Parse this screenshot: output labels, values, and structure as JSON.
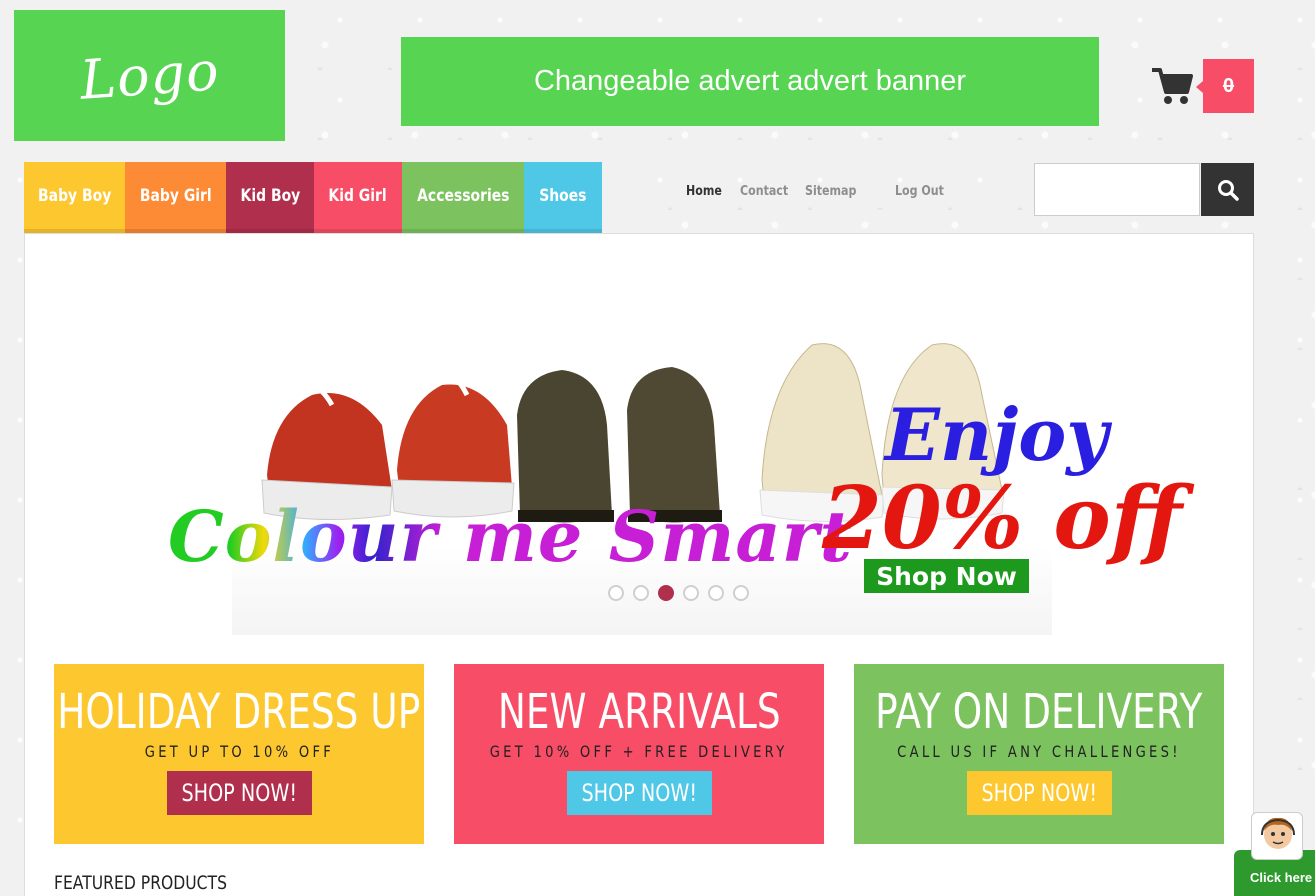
{
  "header": {
    "logo": "Logo",
    "advert": "Changeable advert advert banner",
    "cart_count": "0"
  },
  "categories": [
    {
      "label": "Baby Boy",
      "color": "#fdc72f"
    },
    {
      "label": "Baby Girl",
      "color": "#fd8a34"
    },
    {
      "label": "Kid Boy",
      "color": "#b02f4d"
    },
    {
      "label": "Kid Girl",
      "color": "#f74d66"
    },
    {
      "label": "Accessories",
      "color": "#7cc35f"
    },
    {
      "label": "Shoes",
      "color": "#4fc8e8"
    }
  ],
  "top_links": [
    "Home",
    "Contact",
    "Sitemap",
    "Log Out"
  ],
  "search": {
    "placeholder": ""
  },
  "slider": {
    "slogan": "Colour me Smart",
    "enjoy": "Enjoy",
    "discount": "20% off",
    "cta": "Shop Now",
    "active_slide": 3,
    "slide_count": 6
  },
  "promos": [
    {
      "title": "HOLIDAY DRESS UP",
      "subtitle": "GET UP TO 10% OFF",
      "button": "SHOP NOW!",
      "bg": "#fdc72f",
      "btn_color": "#b02f4d"
    },
    {
      "title": "NEW ARRIVALS",
      "subtitle": "GET 10% OFF + FREE DELIVERY",
      "button": "SHOP NOW!",
      "bg": "#f74d66",
      "btn_color": "#4fc8e8"
    },
    {
      "title": "PAY ON DELIVERY",
      "subtitle": "CALL US IF ANY CHALLENGES!",
      "button": "SHOP NOW!",
      "bg": "#7cc35f",
      "btn_color": "#fdc72f"
    }
  ],
  "featured_heading": "FEATURED PRODUCTS",
  "help_label": "Click here"
}
